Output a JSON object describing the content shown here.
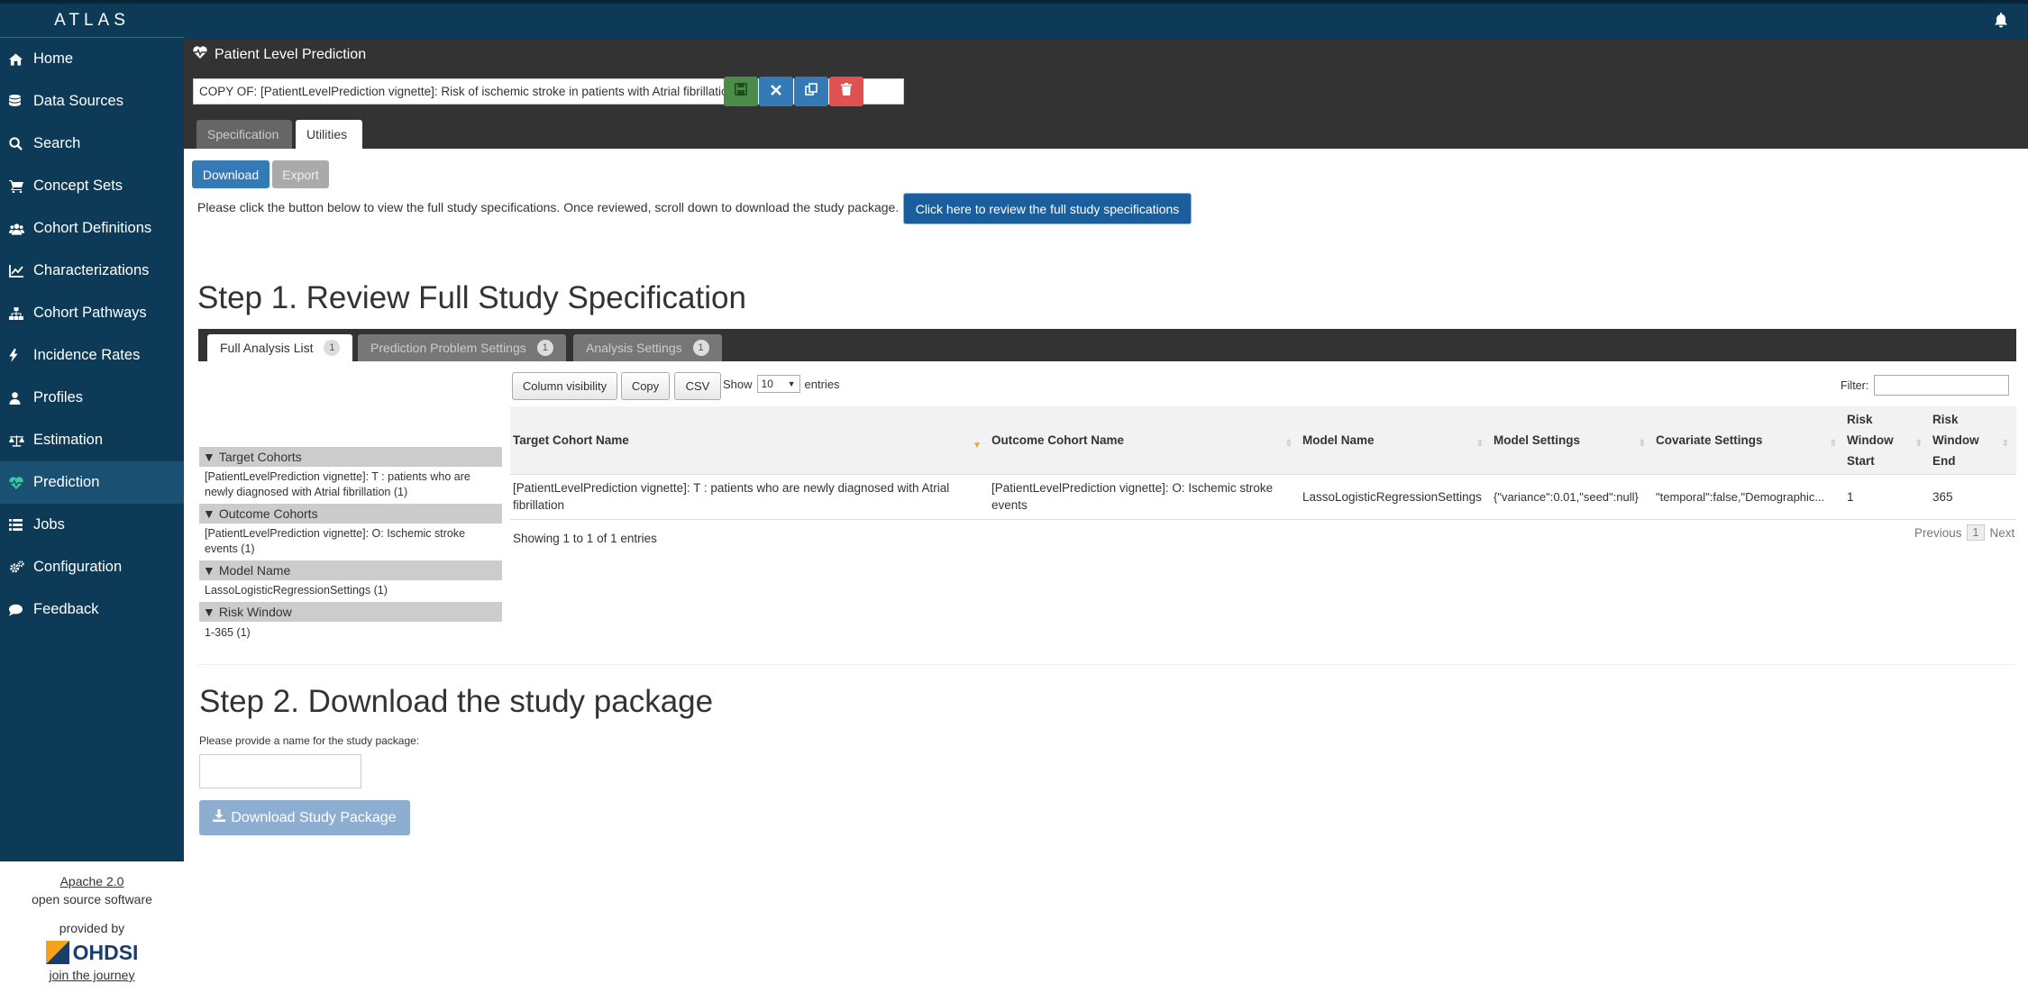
{
  "app": {
    "brand": "ATLAS"
  },
  "sidebar": {
    "items": [
      {
        "label": "Home",
        "icon": "home-icon"
      },
      {
        "label": "Data Sources",
        "icon": "database-icon"
      },
      {
        "label": "Search",
        "icon": "search-icon"
      },
      {
        "label": "Concept Sets",
        "icon": "shopping-cart-icon"
      },
      {
        "label": "Cohort Definitions",
        "icon": "users-icon"
      },
      {
        "label": "Characterizations",
        "icon": "line-chart-icon"
      },
      {
        "label": "Cohort Pathways",
        "icon": "sitemap-icon"
      },
      {
        "label": "Incidence Rates",
        "icon": "bolt-icon"
      },
      {
        "label": "Profiles",
        "icon": "user-icon"
      },
      {
        "label": "Estimation",
        "icon": "balance-scale-icon"
      },
      {
        "label": "Prediction",
        "icon": "heartbeat-icon"
      },
      {
        "label": "Jobs",
        "icon": "list-icon"
      },
      {
        "label": "Configuration",
        "icon": "cogs-icon"
      },
      {
        "label": "Feedback",
        "icon": "comment-icon"
      }
    ],
    "active": "Prediction",
    "footer": {
      "license_link": "Apache 2.0",
      "license_text": "open source software",
      "provided_by": "provided by",
      "logo_text": "OHDSI",
      "journey_link": "join the journey"
    }
  },
  "header": {
    "title": "Patient Level Prediction",
    "name_value": "COPY OF: [PatientLevelPrediction vignette]: Risk of ischemic stroke in patients with Atrial fibrillation",
    "tabs": [
      {
        "label": "Specification"
      },
      {
        "label": "Utilities"
      }
    ],
    "active_tab": "Utilities"
  },
  "utilities": {
    "download_tab": "Download",
    "export_tab": "Export",
    "help_text": "Please click the button below to view the full study specifications. Once reviewed, scroll down to download the study package.",
    "review_button": "Click here to review the full study specifications"
  },
  "step1": {
    "heading": "Step 1. Review Full Study Specification",
    "tabs": [
      {
        "label": "Full Analysis List",
        "count": "1"
      },
      {
        "label": "Prediction Problem Settings",
        "count": "1"
      },
      {
        "label": "Analysis Settings",
        "count": "1"
      }
    ],
    "facets": [
      {
        "title": "Target Cohorts",
        "items": [
          "[PatientLevelPrediction vignette]: T : patients who are newly diagnosed with Atrial fibrillation (1)"
        ]
      },
      {
        "title": "Outcome Cohorts",
        "items": [
          "[PatientLevelPrediction vignette]: O: Ischemic stroke events (1)"
        ]
      },
      {
        "title": "Model Name",
        "items": [
          "LassoLogisticRegressionSettings (1)"
        ]
      },
      {
        "title": "Risk Window",
        "items": [
          "1-365 (1)"
        ]
      }
    ],
    "table": {
      "column_visibility": "Column visibility",
      "copy": "Copy",
      "csv": "CSV",
      "show_label": "Show",
      "entries_value": "10",
      "entries_label": "entries",
      "filter_label": "Filter:",
      "columns": [
        "Target Cohort Name",
        "Outcome Cohort Name",
        "Model Name",
        "Model Settings",
        "Covariate Settings",
        "Risk Window Start",
        "Risk Window End"
      ],
      "rows": [
        [
          "[PatientLevelPrediction vignette]: T : patients who are newly diagnosed with Atrial fibrillation",
          "[PatientLevelPrediction vignette]: O: Ischemic stroke events",
          "LassoLogisticRegressionSettings",
          "{\"variance\":0.01,\"seed\":null}",
          "\"temporal\":false,\"Demographic...",
          "1",
          "365"
        ]
      ],
      "info": "Showing 1 to 1 of 1 entries",
      "previous": "Previous",
      "page": "1",
      "next": "Next"
    }
  },
  "step2": {
    "heading": "Step 2. Download the study package",
    "label": "Please provide a name for the study package:",
    "button": "Download Study Package"
  },
  "colors": {
    "sidebar": "#0d3b57",
    "primary": "#337ab7",
    "success": "#4b8c4b",
    "danger": "#e05252",
    "accent": "#3fc79f"
  }
}
